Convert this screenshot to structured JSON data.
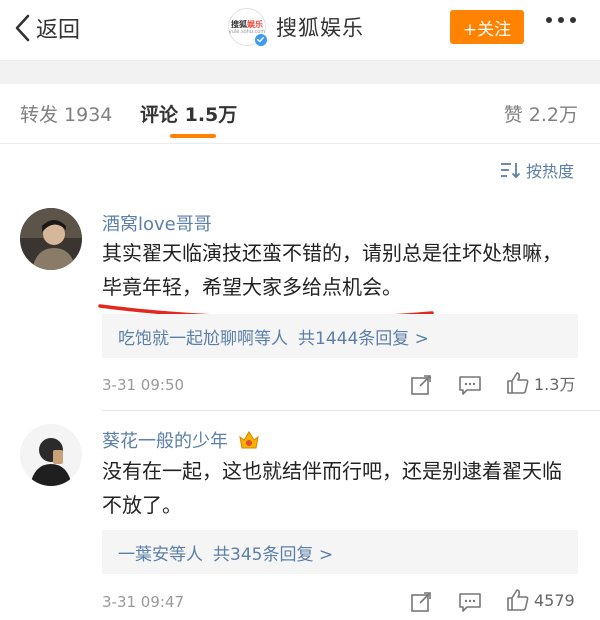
{
  "nav": {
    "back_label": "返回",
    "account_name": "搜狐娱乐",
    "logo_text_a": "搜狐",
    "logo_text_b": "娱乐",
    "logo_subtext": "yule.sohu.com",
    "follow_label": "+关注"
  },
  "tabs": {
    "repost": "转发 1934",
    "comment": "评论 1.5万",
    "like": "赞 2.2万"
  },
  "sort_label": "按热度",
  "comments": [
    {
      "user": "酒窝love哥哥",
      "text": "其实翟天临演技还蛮不错的，请别总是往坏处想嘛，毕竟年轻，希望大家多给点机会。",
      "reply_users": "吃饱就一起尬聊啊等人",
      "reply_count": "共1444条回复 >",
      "time": "3-31 09:50",
      "likes": "1.3万"
    },
    {
      "user": "葵花一般的少年",
      "text": "没有在一起，这也就结伴而行吧，还是别逮着翟天临不放了。",
      "reply_users": "一葉安等人",
      "reply_count": "共345条回复 >",
      "time": "3-31 09:47",
      "likes": "4579"
    }
  ],
  "colors": {
    "accent": "#ff8200",
    "link": "#5b7fa8",
    "annotation": "#e3271c"
  }
}
